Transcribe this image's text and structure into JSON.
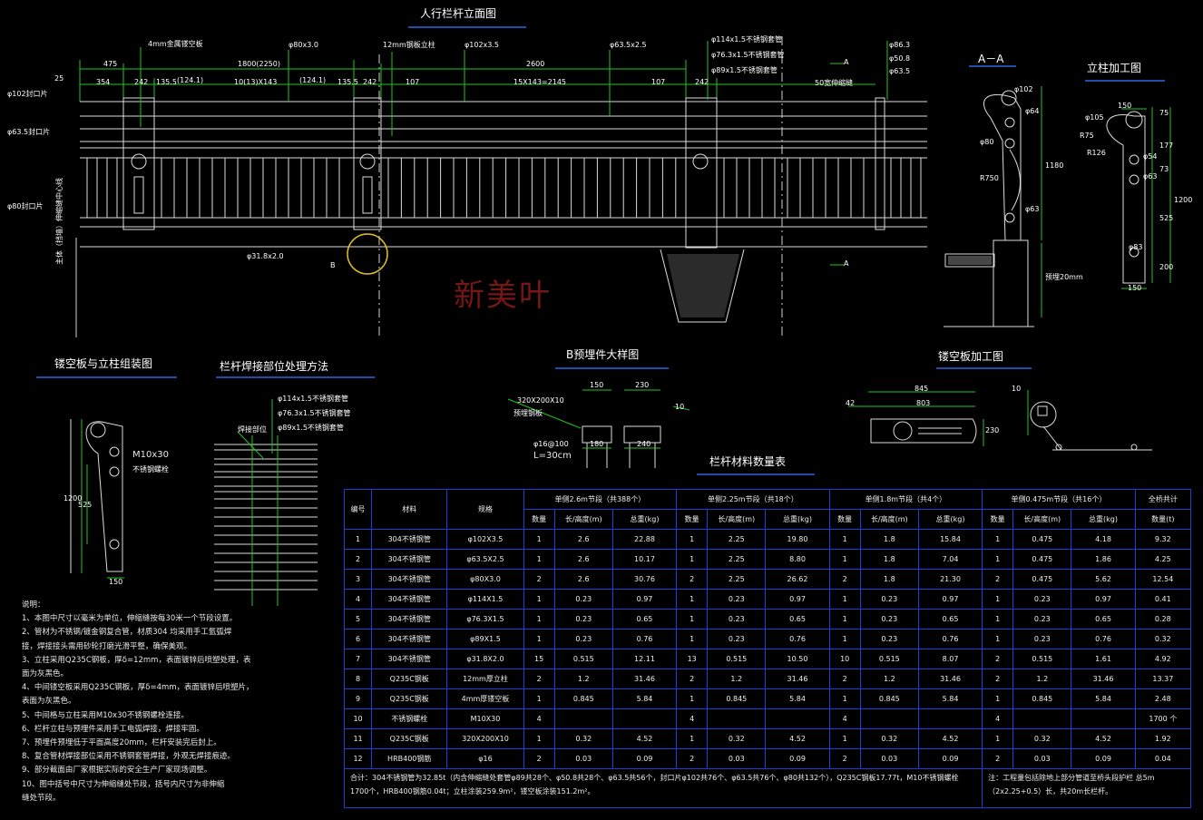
{
  "titles": {
    "elevation": "人行栏杆立面图",
    "section_aa": "A－A",
    "post_machining": "立柱加工图",
    "panel_post_assembly": "镂空板与立柱组装图",
    "weld_treatment": "栏杆焊接部位处理方法",
    "embed_detail": "B预埋件大样图",
    "panel_machining": "镂空板加工图",
    "material_table": "栏杆材料数量表"
  },
  "elevation_labels": {
    "plate_4mm": "4mm金属镂空板",
    "d80x3": "φ80x3.0",
    "plate_12mm": "12mm钢板立柱",
    "d102x35": "φ102x3.5",
    "d635x25": "φ63.5x2.5",
    "d114": "φ114x1.5不锈钢套管",
    "d763": "φ76.3x1.5不锈钢套管",
    "d89": "φ89x1.5不锈钢套管",
    "r_d863": "φ86.3",
    "r_d5": "φ50.8",
    "r_d635": "φ63.5",
    "dim_25": "25",
    "dim_475": "475",
    "dim_1800": "1800(2250)",
    "dim_2600": "2600",
    "dim_354": "354",
    "dim_242a": "242",
    "dim_1355a": "135.5",
    "dim_1241a": "(124.1)",
    "dim_10x143": "10(13)X143",
    "dim_1241b": "(124.1)",
    "dim_1355b": "135.5",
    "dim_242b": "242",
    "dim_107a": "107",
    "dim_15x143": "15X143=2145",
    "dim_107b": "107",
    "dim_242c": "242",
    "seam": "50宽伸缩缝",
    "cap_102": "φ102封口片",
    "cap_635": "φ63.5封口片",
    "cap_80": "φ80封口片",
    "wall_note": "主体（挡墙）伸缩缝中心线",
    "d31": "φ31.8x2.0",
    "mark_b": "B",
    "mark_a1": "A",
    "mark_a2": "A",
    "watermark": "新美叶"
  },
  "section_labels": {
    "d102": "φ102",
    "d64": "φ64",
    "d80": "φ80",
    "r750": "R750",
    "d63": "φ63",
    "h1180": "1180",
    "h_bot": "预埋20mm"
  },
  "post_labels": {
    "d105": "φ105",
    "w150": "150",
    "r75": "R75",
    "r126": "R126",
    "d54": "φ54",
    "d63": "φ63",
    "d83": "φ83",
    "h75": "75",
    "h177": "177",
    "h73": "73",
    "h1200": "1200",
    "h525": "525",
    "h200": "200",
    "b150": "150"
  },
  "assembly_labels": {
    "bolt": "M10x30",
    "bolt2": "不锈钢螺栓",
    "h1200": "1200",
    "h525": "525",
    "b150": "150"
  },
  "weld_labels": {
    "d114": "φ114x1.5不锈钢套管",
    "d763": "φ76.3x1.5不锈钢套管",
    "d89": "φ89x1.5不锈钢套管",
    "weld_pos": "焊接部位"
  },
  "embed_labels": {
    "plate": "320X200X10",
    "plate_note": "预埋钢板",
    "w150": "150",
    "w230": "230",
    "w180": "180",
    "w240": "240",
    "d16": "φ16@100",
    "len": "L=30cm",
    "n10": "10"
  },
  "panel_labels": {
    "w845": "845",
    "w803": "803",
    "w42": "42",
    "h230": "230",
    "t10": "10"
  },
  "notes_title": "说明：",
  "notes": [
    "1、本图中尺寸以毫米为单位，伸缩缝按每30米一个节段设置。",
    "2、管材为不锈钢/镀金钢复合管，材质304  均采用手工氩弧焊",
    "    接，焊接接头需用砂轮打磨光滑平整，确保美观。",
    "3、立柱采用Q235C钢板，厚δ=12mm，表面镀锌后喷塑处理，表",
    "    面为灰黑色。",
    "4、中间镂空板采用Q235C钢板，厚δ=4mm，表面镀锌后喷塑片，",
    "    表面为灰黑色。",
    "5、中间格与立柱采用M10x30不锈钢螺栓连接。",
    "6、栏杆立柱与预埋件采用手工电弧焊接，焊接牢固。",
    "7、预埋件预埋低于平面高度20mm，栏杆安装完后封上。",
    "8、复合管材焊接部位采用不锈钢套管焊接，外观无焊接痕迹。",
    "9、部分截面由厂家根据实际的安全生产厂家现场调整。",
    "10、图中括号中尺寸为伸缩缝处节段，括号内尺寸为非伸缩",
    "     缝处节段。"
  ],
  "table": {
    "headers": {
      "no": "编号",
      "material": "材料",
      "spec": "规格",
      "g1": "单侧2.6m节段（共388个）",
      "g2": "单侧2.25m节段（共18个）",
      "g3": "单侧1.8m节段（共4个）",
      "g4": "单侧0.475m节段（共16个）",
      "total": "全桥共计",
      "qty": "数量",
      "len": "长/高度(m)",
      "wt": "总重(kg)",
      "tqty": "数量(t)"
    },
    "rows": [
      [
        "1",
        "304不锈钢管",
        "φ102X3.5",
        "1",
        "2.6",
        "22.88",
        "1",
        "2.25",
        "19.80",
        "1",
        "1.8",
        "15.84",
        "1",
        "0.475",
        "4.18",
        "9.32"
      ],
      [
        "2",
        "304不锈钢管",
        "φ63.5X2.5",
        "1",
        "2.6",
        "10.17",
        "1",
        "2.25",
        "8.80",
        "1",
        "1.8",
        "7.04",
        "1",
        "0.475",
        "1.86",
        "4.25"
      ],
      [
        "3",
        "304不锈钢管",
        "φ80X3.0",
        "2",
        "2.6",
        "30.76",
        "2",
        "2.25",
        "26.62",
        "2",
        "1.8",
        "21.30",
        "2",
        "0.475",
        "5.62",
        "12.54"
      ],
      [
        "4",
        "304不锈钢管",
        "φ114X1.5",
        "1",
        "0.23",
        "0.97",
        "1",
        "0.23",
        "0.97",
        "1",
        "0.23",
        "0.97",
        "1",
        "0.23",
        "0.97",
        "0.41"
      ],
      [
        "5",
        "304不锈钢管",
        "φ76.3X1.5",
        "1",
        "0.23",
        "0.65",
        "1",
        "0.23",
        "0.65",
        "1",
        "0.23",
        "0.65",
        "1",
        "0.23",
        "0.65",
        "0.28"
      ],
      [
        "6",
        "304不锈钢管",
        "φ89X1.5",
        "1",
        "0.23",
        "0.76",
        "1",
        "0.23",
        "0.76",
        "1",
        "0.23",
        "0.76",
        "1",
        "0.23",
        "0.76",
        "0.32"
      ],
      [
        "7",
        "304不锈钢管",
        "φ31.8X2.0",
        "15",
        "0.515",
        "12.11",
        "13",
        "0.515",
        "10.50",
        "10",
        "0.515",
        "8.07",
        "2",
        "0.515",
        "1.61",
        "4.92"
      ],
      [
        "8",
        "Q235C钢板",
        "12mm厚立柱",
        "2",
        "1.2",
        "31.46",
        "2",
        "1.2",
        "31.46",
        "2",
        "1.2",
        "31.46",
        "2",
        "1.2",
        "31.46",
        "13.37"
      ],
      [
        "9",
        "Q235C钢板",
        "4mm厚镂空板",
        "1",
        "0.845",
        "5.84",
        "1",
        "0.845",
        "5.84",
        "1",
        "0.845",
        "5.84",
        "1",
        "0.845",
        "5.84",
        "2.48"
      ],
      [
        "10",
        "不锈钢螺栓",
        "M10X30",
        "4",
        "",
        "",
        "4",
        "",
        "",
        "4",
        "",
        "",
        "4",
        "",
        "",
        "1700 个"
      ],
      [
        "11",
        "Q235C钢板",
        "320X200X10",
        "1",
        "0.32",
        "4.52",
        "1",
        "0.32",
        "4.52",
        "1",
        "0.32",
        "4.52",
        "1",
        "0.32",
        "4.52",
        "1.92"
      ],
      [
        "12",
        "HRB400钢筋",
        "φ16",
        "2",
        "0.03",
        "0.09",
        "2",
        "0.03",
        "0.09",
        "2",
        "0.03",
        "0.09",
        "2",
        "0.03",
        "0.09",
        "0.04"
      ]
    ],
    "footer_left": "合计：304不锈钢管为32.85t（内含伸缩缝处套管φ89共28个、φ50.8共28个、φ63.5共56个，封口片φ102共76个、φ63.5共76个、φ80共132个），Q235C钢板17.77t，M10不锈钢螺栓1700个，HRB400钢筋0.04t；立柱涂装259.9m²，镂空板涂装151.2m²。",
    "footer_right": "注：工程量包括除地上部分管道至桥头段护栏 总5m（2x2.25+0.5）长，共20m长栏杆。"
  }
}
